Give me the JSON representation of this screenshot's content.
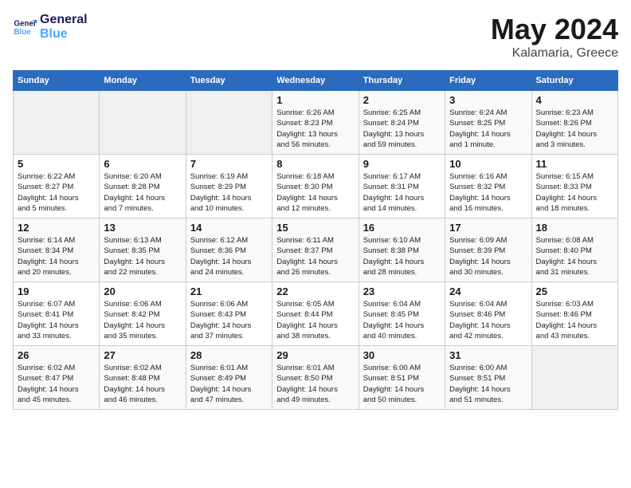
{
  "header": {
    "logo_line1": "General",
    "logo_line2": "Blue",
    "month": "May 2024",
    "location": "Kalamaria, Greece"
  },
  "days_of_week": [
    "Sunday",
    "Monday",
    "Tuesday",
    "Wednesday",
    "Thursday",
    "Friday",
    "Saturday"
  ],
  "weeks": [
    [
      {
        "num": "",
        "info": ""
      },
      {
        "num": "",
        "info": ""
      },
      {
        "num": "",
        "info": ""
      },
      {
        "num": "1",
        "info": "Sunrise: 6:26 AM\nSunset: 8:23 PM\nDaylight: 13 hours\nand 56 minutes."
      },
      {
        "num": "2",
        "info": "Sunrise: 6:25 AM\nSunset: 8:24 PM\nDaylight: 13 hours\nand 59 minutes."
      },
      {
        "num": "3",
        "info": "Sunrise: 6:24 AM\nSunset: 8:25 PM\nDaylight: 14 hours\nand 1 minute."
      },
      {
        "num": "4",
        "info": "Sunrise: 6:23 AM\nSunset: 8:26 PM\nDaylight: 14 hours\nand 3 minutes."
      }
    ],
    [
      {
        "num": "5",
        "info": "Sunrise: 6:22 AM\nSunset: 8:27 PM\nDaylight: 14 hours\nand 5 minutes."
      },
      {
        "num": "6",
        "info": "Sunrise: 6:20 AM\nSunset: 8:28 PM\nDaylight: 14 hours\nand 7 minutes."
      },
      {
        "num": "7",
        "info": "Sunrise: 6:19 AM\nSunset: 8:29 PM\nDaylight: 14 hours\nand 10 minutes."
      },
      {
        "num": "8",
        "info": "Sunrise: 6:18 AM\nSunset: 8:30 PM\nDaylight: 14 hours\nand 12 minutes."
      },
      {
        "num": "9",
        "info": "Sunrise: 6:17 AM\nSunset: 8:31 PM\nDaylight: 14 hours\nand 14 minutes."
      },
      {
        "num": "10",
        "info": "Sunrise: 6:16 AM\nSunset: 8:32 PM\nDaylight: 14 hours\nand 16 minutes."
      },
      {
        "num": "11",
        "info": "Sunrise: 6:15 AM\nSunset: 8:33 PM\nDaylight: 14 hours\nand 18 minutes."
      }
    ],
    [
      {
        "num": "12",
        "info": "Sunrise: 6:14 AM\nSunset: 8:34 PM\nDaylight: 14 hours\nand 20 minutes."
      },
      {
        "num": "13",
        "info": "Sunrise: 6:13 AM\nSunset: 8:35 PM\nDaylight: 14 hours\nand 22 minutes."
      },
      {
        "num": "14",
        "info": "Sunrise: 6:12 AM\nSunset: 8:36 PM\nDaylight: 14 hours\nand 24 minutes."
      },
      {
        "num": "15",
        "info": "Sunrise: 6:11 AM\nSunset: 8:37 PM\nDaylight: 14 hours\nand 26 minutes."
      },
      {
        "num": "16",
        "info": "Sunrise: 6:10 AM\nSunset: 8:38 PM\nDaylight: 14 hours\nand 28 minutes."
      },
      {
        "num": "17",
        "info": "Sunrise: 6:09 AM\nSunset: 8:39 PM\nDaylight: 14 hours\nand 30 minutes."
      },
      {
        "num": "18",
        "info": "Sunrise: 6:08 AM\nSunset: 8:40 PM\nDaylight: 14 hours\nand 31 minutes."
      }
    ],
    [
      {
        "num": "19",
        "info": "Sunrise: 6:07 AM\nSunset: 8:41 PM\nDaylight: 14 hours\nand 33 minutes."
      },
      {
        "num": "20",
        "info": "Sunrise: 6:06 AM\nSunset: 8:42 PM\nDaylight: 14 hours\nand 35 minutes."
      },
      {
        "num": "21",
        "info": "Sunrise: 6:06 AM\nSunset: 8:43 PM\nDaylight: 14 hours\nand 37 minutes."
      },
      {
        "num": "22",
        "info": "Sunrise: 6:05 AM\nSunset: 8:44 PM\nDaylight: 14 hours\nand 38 minutes."
      },
      {
        "num": "23",
        "info": "Sunrise: 6:04 AM\nSunset: 8:45 PM\nDaylight: 14 hours\nand 40 minutes."
      },
      {
        "num": "24",
        "info": "Sunrise: 6:04 AM\nSunset: 8:46 PM\nDaylight: 14 hours\nand 42 minutes."
      },
      {
        "num": "25",
        "info": "Sunrise: 6:03 AM\nSunset: 8:46 PM\nDaylight: 14 hours\nand 43 minutes."
      }
    ],
    [
      {
        "num": "26",
        "info": "Sunrise: 6:02 AM\nSunset: 8:47 PM\nDaylight: 14 hours\nand 45 minutes."
      },
      {
        "num": "27",
        "info": "Sunrise: 6:02 AM\nSunset: 8:48 PM\nDaylight: 14 hours\nand 46 minutes."
      },
      {
        "num": "28",
        "info": "Sunrise: 6:01 AM\nSunset: 8:49 PM\nDaylight: 14 hours\nand 47 minutes."
      },
      {
        "num": "29",
        "info": "Sunrise: 6:01 AM\nSunset: 8:50 PM\nDaylight: 14 hours\nand 49 minutes."
      },
      {
        "num": "30",
        "info": "Sunrise: 6:00 AM\nSunset: 8:51 PM\nDaylight: 14 hours\nand 50 minutes."
      },
      {
        "num": "31",
        "info": "Sunrise: 6:00 AM\nSunset: 8:51 PM\nDaylight: 14 hours\nand 51 minutes."
      },
      {
        "num": "",
        "info": ""
      }
    ]
  ]
}
